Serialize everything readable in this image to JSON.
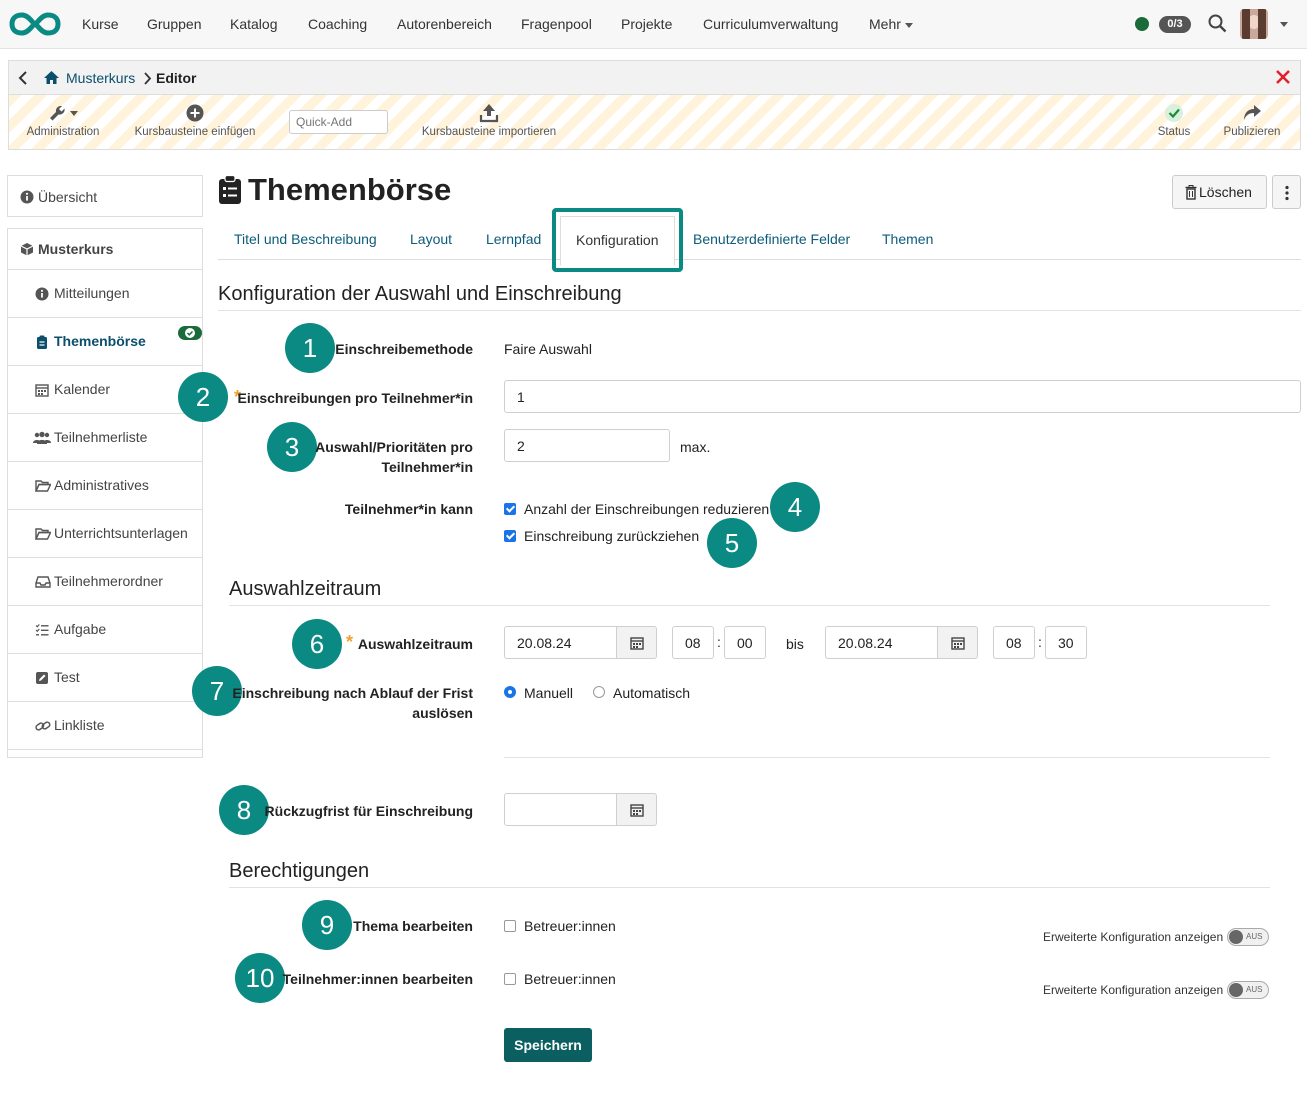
{
  "nav": {
    "items": [
      "Kurse",
      "Gruppen",
      "Katalog",
      "Coaching",
      "Autorenbereich",
      "Fragenpool",
      "Projekte",
      "Curriculumverwaltung",
      "Mehr"
    ],
    "counter": "0/3",
    "colors": {
      "logo": "#0b8a83",
      "status_dot": "#1b6b3a"
    }
  },
  "breadcrumb": {
    "course": "Musterkurs",
    "current": "Editor"
  },
  "toolbar": {
    "administration": "Administration",
    "insert": "Kursbausteine einfügen",
    "quickadd_placeholder": "Quick-Add",
    "import": "Kursbausteine importieren",
    "status": "Status",
    "publish": "Publizieren"
  },
  "sidebar": {
    "overview": "Übersicht",
    "course": "Musterkurs",
    "items": [
      "Mitteilungen",
      "Themenbörse",
      "Kalender",
      "Teilnehmerliste",
      "Administratives",
      "Unterrichtsunterlagen",
      "Teilnehmerordner",
      "Aufgabe",
      "Test",
      "Linkliste"
    ],
    "active_index": 1
  },
  "page": {
    "title": "Themenbörse",
    "delete_label": "Löschen",
    "tabs": [
      "Titel und Beschreibung",
      "Layout",
      "Lernpfad",
      "Konfiguration",
      "Benutzerdefinierte Felder",
      "Themen"
    ],
    "active_tab": "Konfiguration"
  },
  "config": {
    "heading": "Konfiguration der Auswahl und Einschreibung",
    "method_label": "Einschreibemethode",
    "method_value": "Faire Auswahl",
    "enroll_label": "Einschreibungen pro Teilnehmer*in",
    "enroll_value": "1",
    "prio_label_1": "Auswahl/Prioritäten pro",
    "prio_label_2": "Teilnehmer*in",
    "prio_value": "2",
    "prio_suffix": "max.",
    "can_label": "Teilnehmer*in kann",
    "can_reduce": "Anzahl der Einschreibungen reduzieren",
    "can_withdraw": "Einschreibung zurückziehen"
  },
  "period": {
    "heading": "Auswahlzeitraum",
    "label": "Auswahlzeitraum",
    "start_date": "20.08.24",
    "start_hour": "08",
    "start_min": "00",
    "until": "bis",
    "end_date": "20.08.24",
    "end_hour": "08",
    "end_min": "30",
    "after_label_1": "Einschreibung nach Ablauf der Frist",
    "after_label_2": "auslösen",
    "manual": "Manuell",
    "automatic": "Automatisch",
    "withdraw_label": "Rückzugfrist für Einschreibung"
  },
  "permissions": {
    "heading": "Berechtigungen",
    "edit_topic": "Thema bearbeiten",
    "edit_participants": "Teilnehmer:innen bearbeiten",
    "coaches": "Betreuer:innen",
    "advanced": "Erweiterte Konfiguration anzeigen",
    "toggle_off": "AUS"
  },
  "save_label": "Speichern",
  "callouts": [
    "1",
    "2",
    "3",
    "4",
    "5",
    "6",
    "7",
    "8",
    "9",
    "10"
  ],
  "colors": {
    "accent": "#0b8a83",
    "primary_btn": "#0b5f60",
    "link": "#0b5b7a",
    "required": "#f0a030",
    "close": "#e0202a"
  }
}
